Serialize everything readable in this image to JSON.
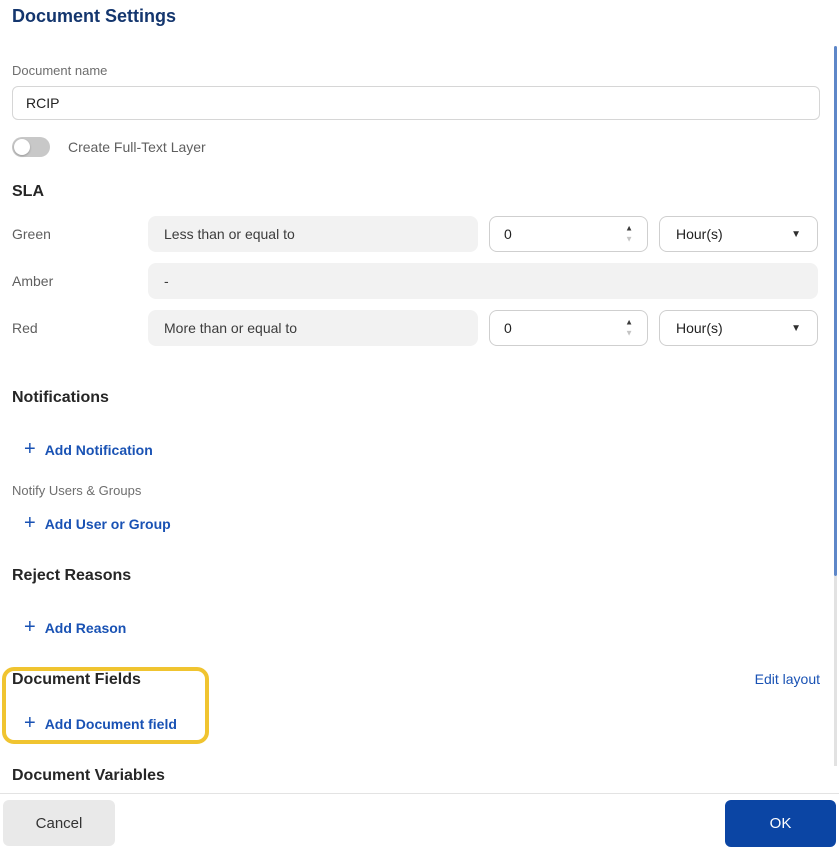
{
  "page": {
    "title": "Document Settings"
  },
  "document_name": {
    "label": "Document name",
    "value": "RCIP"
  },
  "full_text_toggle": {
    "label": "Create Full-Text Layer",
    "state": "off"
  },
  "sla": {
    "heading": "SLA",
    "rows": [
      {
        "label": "Green",
        "condition": "Less than or equal to",
        "value": "0",
        "unit": "Hour(s)"
      },
      {
        "label": "Amber",
        "condition": "-"
      },
      {
        "label": "Red",
        "condition": "More than or equal to",
        "value": "0",
        "unit": "Hour(s)"
      }
    ]
  },
  "notifications": {
    "heading": "Notifications",
    "add_notification_label": "Add Notification",
    "notify_users_groups_label": "Notify Users & Groups",
    "add_user_or_group_label": "Add User or Group"
  },
  "reject_reasons": {
    "heading": "Reject Reasons",
    "add_reason_label": "Add Reason"
  },
  "document_fields": {
    "heading": "Document Fields",
    "add_field_label": "Add Document field",
    "edit_layout_label": "Edit layout"
  },
  "document_variables": {
    "heading": "Document Variables"
  },
  "footer": {
    "cancel_label": "Cancel",
    "ok_label": "OK"
  },
  "icons": {
    "plus": "+",
    "caret_down": "▼",
    "spinner_up": "▲",
    "spinner_down": "▼"
  },
  "colors": {
    "title_blue": "#14366e",
    "link_blue": "#1952b4",
    "ok_button_blue": "#0b45a4",
    "highlight_yellow": "#f0c430",
    "condition_field_gray": "#f2f2f2",
    "scrollbar_thumb_blue": "#5e87c8"
  }
}
